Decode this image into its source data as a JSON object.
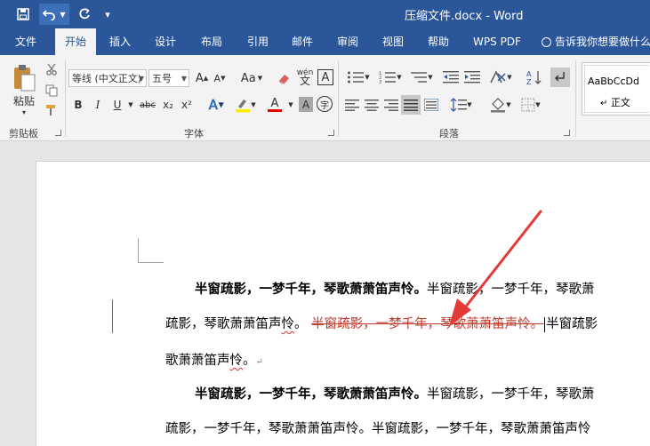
{
  "titlebar": {
    "title": "压缩文件.docx  -  Word",
    "undo_icon": "undo-icon",
    "redo_icon": "redo-icon",
    "save_icon": "save-icon"
  },
  "tabs": [
    "文件",
    "开始",
    "插入",
    "设计",
    "布局",
    "引用",
    "邮件",
    "审阅",
    "视图",
    "帮助",
    "WPS PDF"
  ],
  "active_tab": "开始",
  "tellme": "告诉我你想要做什么",
  "ribbon": {
    "paste_label": "粘贴",
    "clipboard_group": "剪贴板",
    "font_group": "字体",
    "paragraph_group": "段落",
    "font_name": "等线 (中文正文)",
    "font_size": "五号",
    "font_grow": "A",
    "font_shrink": "A",
    "change_case": "Aa",
    "phonetic": "wén",
    "char_border": "A",
    "bold": "B",
    "italic": "I",
    "underline": "U",
    "strikethrough": "abc",
    "subscript": "x₂",
    "superscript": "x²",
    "text_effect": "A",
    "font_color": "A",
    "char_shading": "A",
    "enclose_char": "字",
    "style_preview": "AaBbCcDd",
    "style_name": "正文"
  },
  "document": {
    "para1_bold": "半窗疏影，一梦千年，琴歌萧萧笛声怜。",
    "para1_rest_line1": "半窗疏影，一梦千年，琴歌萧",
    "para1_line2_start": "疏影，琴歌萧萧笛声",
    "para1_line2_squig": "怜",
    "para1_line2_period": "。",
    "para1_deleted": "半窗疏影，一梦千年，琴歌萧萧笛声怜。",
    "para1_line2_end": "半窗疏影",
    "para1_line3": "歌萧萧笛声",
    "para1_line3_squig": "怜",
    "para1_line3_end": "。",
    "para_mark": "↵",
    "para2_bold": "半窗疏影，一梦千年，琴歌萧萧笛声怜。",
    "para2_rest_line1": "半窗疏影，一梦千年，琴歌萧",
    "para2_line2": "疏影，一梦千年，琴歌萧萧笛声怜。半窗疏影，一梦千年，琴歌萧萧笛声怜"
  },
  "colors": {
    "titlebar": "#2b579a",
    "ribbon": "#f3f3f3",
    "arrow": "#e53935",
    "deleted_text": "#c0392b"
  }
}
